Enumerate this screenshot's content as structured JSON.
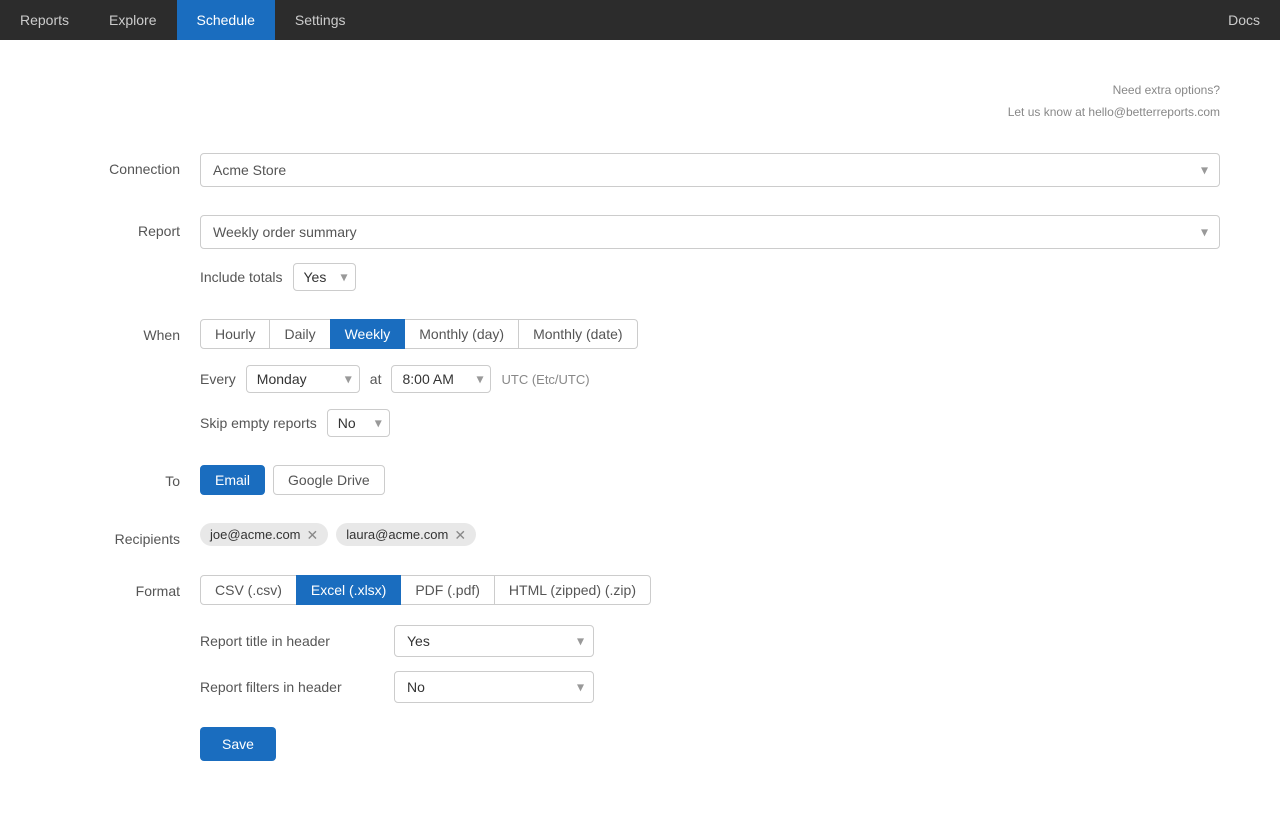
{
  "nav": {
    "items": [
      {
        "id": "reports",
        "label": "Reports",
        "active": false
      },
      {
        "id": "explore",
        "label": "Explore",
        "active": false
      },
      {
        "id": "schedule",
        "label": "Schedule",
        "active": true
      },
      {
        "id": "settings",
        "label": "Settings",
        "active": false
      }
    ],
    "right_label": "Docs"
  },
  "help": {
    "line1": "Need extra options?",
    "line2": "Let us know at hello@betterreports.com"
  },
  "form": {
    "connection_label": "Connection",
    "connection_value": "Acme Store",
    "report_label": "Report",
    "report_value": "Weekly order summary",
    "include_totals_label": "Include totals",
    "include_totals_value": "Yes",
    "when_label": "When",
    "frequency_tabs": [
      {
        "id": "hourly",
        "label": "Hourly",
        "active": false
      },
      {
        "id": "daily",
        "label": "Daily",
        "active": false
      },
      {
        "id": "weekly",
        "label": "Weekly",
        "active": true
      },
      {
        "id": "monthly_day",
        "label": "Monthly (day)",
        "active": false
      },
      {
        "id": "monthly_date",
        "label": "Monthly (date)",
        "active": false
      }
    ],
    "every_label": "Every",
    "every_value": "Monday",
    "at_label": "at",
    "at_value": "8:00 AM",
    "timezone_label": "UTC (Etc/UTC)",
    "skip_label": "Skip empty reports",
    "skip_value": "No",
    "to_label": "To",
    "to_buttons": [
      {
        "id": "email",
        "label": "Email",
        "active": true
      },
      {
        "id": "google_drive",
        "label": "Google Drive",
        "active": false
      }
    ],
    "recipients_label": "Recipients",
    "recipients": [
      {
        "email": "joe@acme.com"
      },
      {
        "email": "laura@acme.com"
      }
    ],
    "format_label": "Format",
    "format_buttons": [
      {
        "id": "csv",
        "label": "CSV (.csv)",
        "active": false
      },
      {
        "id": "excel",
        "label": "Excel (.xlsx)",
        "active": true
      },
      {
        "id": "pdf",
        "label": "PDF (.pdf)",
        "active": false
      },
      {
        "id": "html",
        "label": "HTML (zipped) (.zip)",
        "active": false
      }
    ],
    "report_title_header_label": "Report title in header",
    "report_title_header_value": "Yes",
    "report_filters_header_label": "Report filters in header",
    "report_filters_header_value": "No",
    "save_label": "Save"
  }
}
